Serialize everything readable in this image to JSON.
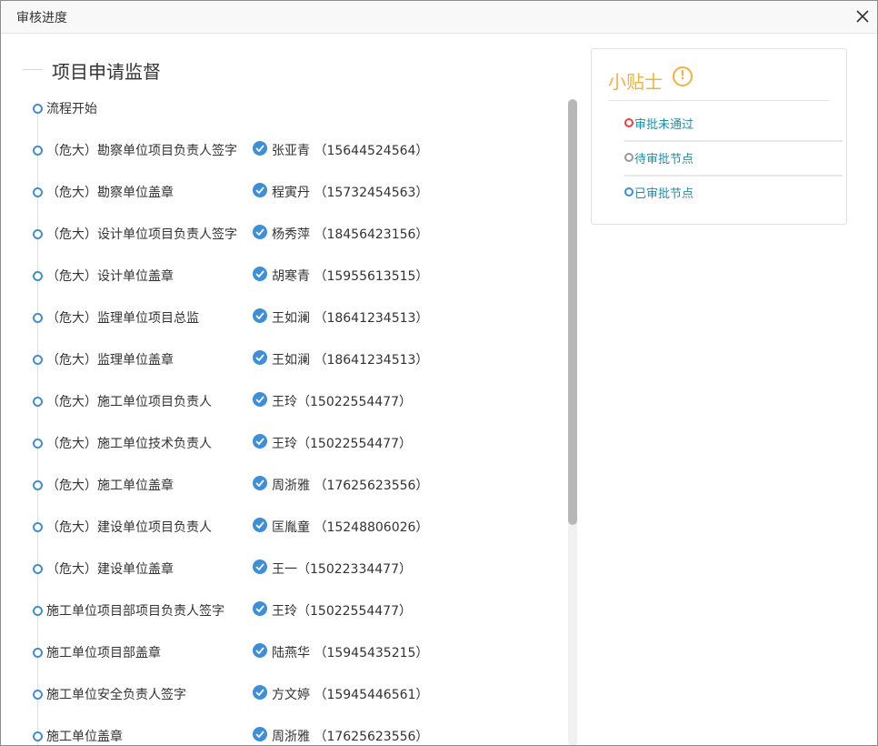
{
  "dialog": {
    "title": "审核进度"
  },
  "section_title": "项目申请监督",
  "flow": {
    "start": "流程开始",
    "steps": [
      {
        "name": "（危大）勘察单位项目负责人签字",
        "approver": "张亚青 （15644524564）"
      },
      {
        "name": "（危大）勘察单位盖章",
        "approver": "程寅丹 （15732454563）"
      },
      {
        "name": "（危大）设计单位项目负责人签字",
        "approver": "杨秀萍 （18456423156）"
      },
      {
        "name": "（危大）设计单位盖章",
        "approver": "胡寒青 （15955613515）"
      },
      {
        "name": "（危大）监理单位项目总监",
        "approver": "王如澜 （18641234513）"
      },
      {
        "name": "（危大）监理单位盖章",
        "approver": "王如澜 （18641234513）"
      },
      {
        "name": "（危大）施工单位项目负责人",
        "approver": "王玲（15022554477）"
      },
      {
        "name": "（危大）施工单位技术负责人",
        "approver": "王玲（15022554477）"
      },
      {
        "name": "（危大）施工单位盖章",
        "approver": "周浙雅 （17625623556）"
      },
      {
        "name": "（危大）建设单位项目负责人",
        "approver": "匡胤童 （15248806026）"
      },
      {
        "name": "（危大）建设单位盖章",
        "approver": "王一（15022334477）"
      },
      {
        "name": "施工单位项目部项目负责人签字",
        "approver": "王玲（15022554477）"
      },
      {
        "name": "施工单位项目部盖章",
        "approver": "陆燕华 （15945435215）"
      },
      {
        "name": "施工单位安全负责人签字",
        "approver": "方文婷 （15945446561）"
      },
      {
        "name": "施工单位盖章",
        "approver": "周浙雅 （17625623556）"
      }
    ]
  },
  "tips": {
    "title": "小贴士",
    "legend": [
      {
        "label": "审批未通过",
        "color": "#e8413b"
      },
      {
        "label": "待审批节点",
        "color": "#999999"
      },
      {
        "label": "已审批节点",
        "color": "#3d8fd9"
      }
    ]
  },
  "colors": {
    "accent": "#3d8fd9",
    "tip": "#f3b23b",
    "link": "#1e90a8"
  },
  "icons": {
    "close": "close-icon",
    "check": "check-circle-icon",
    "warning": "exclamation-circle-icon"
  }
}
